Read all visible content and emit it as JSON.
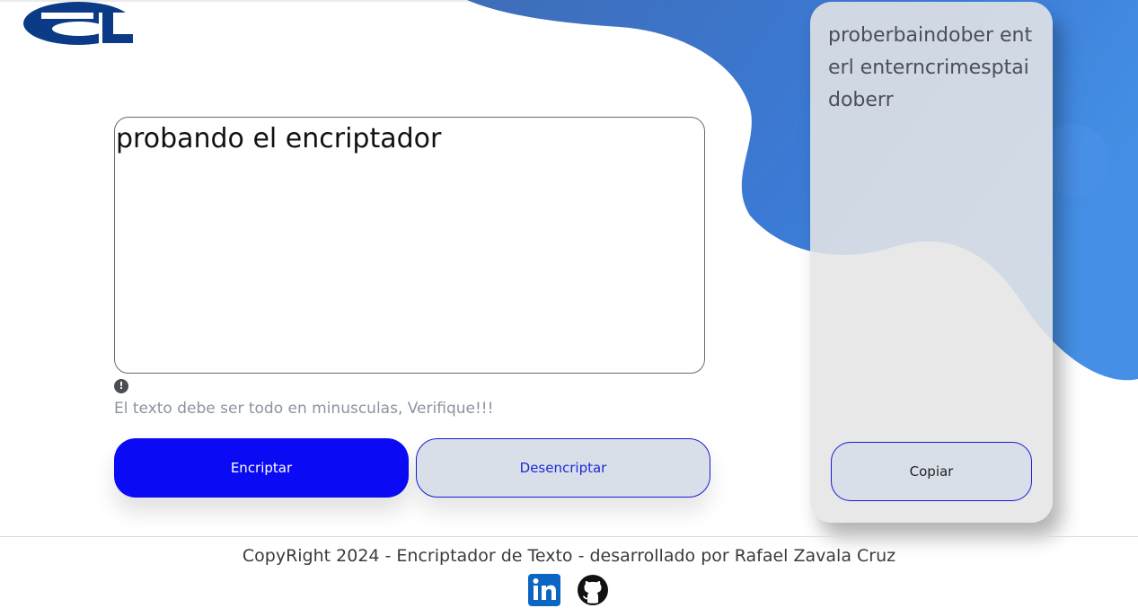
{
  "app": {
    "title": "Encriptador de Texto",
    "logo_icon": "alura-logo-icon",
    "accent_color": "#0a0af5",
    "blob_color": "#3b78d0"
  },
  "input": {
    "value": "probando el encriptador"
  },
  "warning": {
    "icon": "exclamation-circle-icon",
    "text": "El texto debe ser todo en minusculas, Verifique!!!"
  },
  "buttons": {
    "encrypt_label": "Encriptar",
    "decrypt_label": "Desencriptar",
    "copy_label": "Copiar"
  },
  "output": {
    "text": "proberbaindober enterl enterncrimesptaidoberr"
  },
  "footer": {
    "copyright": "CopyRight 2024 - Encriptador de Texto - desarrollado por Rafael Zavala Cruz",
    "social": [
      "linkedin-icon",
      "github-icon"
    ]
  }
}
